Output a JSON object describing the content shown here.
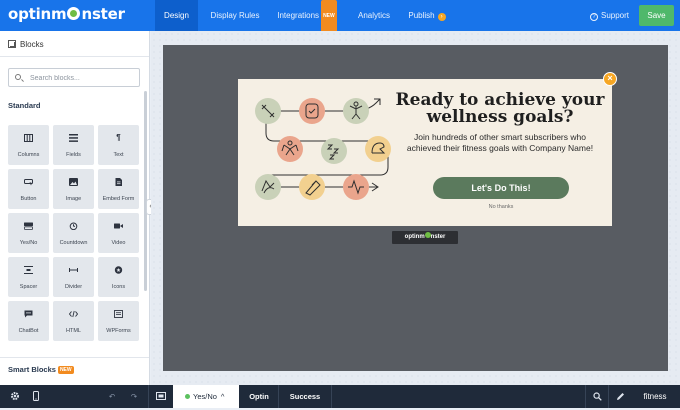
{
  "app": {
    "logo_text_a": "optinm",
    "logo_text_b": "nster"
  },
  "nav": {
    "tabs": [
      {
        "label": "Design",
        "active": true
      },
      {
        "label": "Display Rules",
        "active": false
      },
      {
        "label": "Integrations",
        "badge": "NEW",
        "active": false
      },
      {
        "label": "Analytics",
        "active": false
      },
      {
        "label": "Publish",
        "active": false
      }
    ],
    "support_label": "Support",
    "save_label": "Save"
  },
  "sidebar": {
    "title": "Blocks",
    "search_placeholder": "Search blocks...",
    "standard_title": "Standard",
    "blocks": [
      {
        "label": "Columns",
        "icon": "columns-icon"
      },
      {
        "label": "Fields",
        "icon": "fields-icon"
      },
      {
        "label": "Text",
        "icon": "text-icon"
      },
      {
        "label": "Button",
        "icon": "button-icon"
      },
      {
        "label": "Image",
        "icon": "image-icon"
      },
      {
        "label": "Embed Form",
        "icon": "embed-form-icon"
      },
      {
        "label": "Yes/No",
        "icon": "yes-no-icon"
      },
      {
        "label": "Countdown",
        "icon": "countdown-icon"
      },
      {
        "label": "Video",
        "icon": "video-icon"
      },
      {
        "label": "Spacer",
        "icon": "spacer-icon"
      },
      {
        "label": "Divider",
        "icon": "divider-icon"
      },
      {
        "label": "Icons",
        "icon": "icons-icon"
      },
      {
        "label": "ChatBot",
        "icon": "chatbot-icon"
      },
      {
        "label": "HTML",
        "icon": "html-icon"
      },
      {
        "label": "WPForms",
        "icon": "wpforms-icon"
      }
    ],
    "smart_title": "Smart Blocks",
    "smart_badge": "NEW"
  },
  "popup": {
    "headline": "Ready to achieve your wellness goals?",
    "subtext": "Join hundreds of other smart subscribers who achieved their fitness goals with Company Name!",
    "cta_label": "Let's Do This!",
    "no_thanks": "No thanks",
    "close_glyph": "×",
    "powered_badge_a": "optinm",
    "powered_badge_b": "nster"
  },
  "bottom": {
    "yes_no_label": "Yes/No",
    "optin_label": "Optin",
    "success_label": "Success",
    "campaign_name": "fitness"
  },
  "colors": {
    "brand_blue": "#1874ea",
    "save_green": "#4fb86b",
    "cta_green": "#5b7a5d",
    "accent_orange": "#f6a623"
  }
}
